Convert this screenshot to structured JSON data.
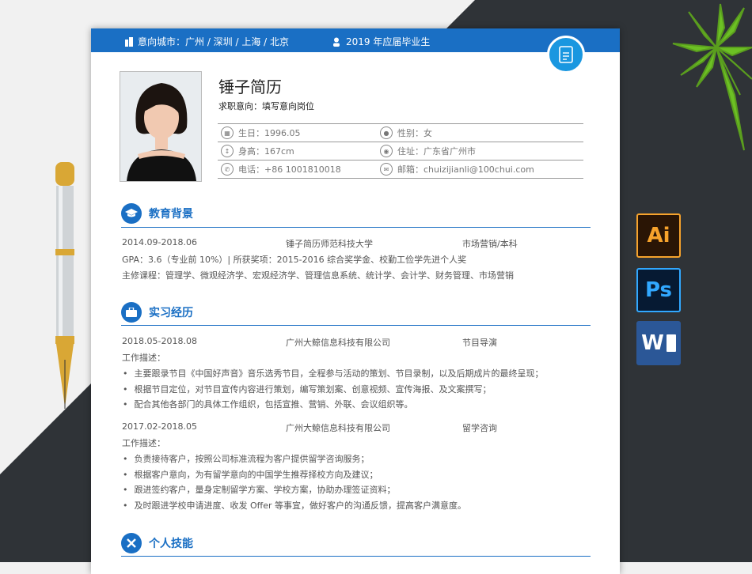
{
  "header": {
    "cities": "意向城市：广州 / 深圳 / 上海 / 北京",
    "grad": "2019 年应届毕业生"
  },
  "profile": {
    "name": "锤子简历",
    "intent": "求职意向：填写意向岗位",
    "birth": "生日：1996.05",
    "gender": "性别：女",
    "height": "身高：167cm",
    "address": "住址：广东省广州市",
    "phone": "电话：+86 1001810018",
    "email": "邮箱：chuizijianli@100chui.com"
  },
  "education": {
    "title": "教育背景",
    "period": "2014.09-2018.06",
    "school": "锤子简历师范科技大学",
    "major": "市场营销/本科",
    "gpa": "GPA：3.6（专业前 10%）| 所获奖项：2015-2016 综合奖学金、校勤工俭学先进个人奖",
    "courses": "主修课程：管理学、微观经济学、宏观经济学、管理信息系统、统计学、会计学、财务管理、市场营销"
  },
  "internship": {
    "title": "实习经历",
    "jobs": [
      {
        "period": "2018.05-2018.08",
        "company": "广州大鲸信息科技有限公司",
        "role": "节目导演",
        "desc_label": "工作描述：",
        "bullets": [
          "主要跟录节目《中国好声音》音乐选秀节目，全程参与活动的策划、节目录制，以及后期成片的最终呈现；",
          "根据节目定位，对节目宣传内容进行策划，编写策划案、创意视频、宣传海报、及文案撰写；",
          "配合其他各部门的具体工作组织，包括宣推、营销、外联、会议组织等。"
        ]
      },
      {
        "period": "2017.02-2018.05",
        "company": "广州大鲸信息科技有限公司",
        "role": "留学咨询",
        "desc_label": "工作描述：",
        "bullets": [
          "负责接待客户，按照公司标准流程为客户提供留学咨询服务；",
          "根据客户意向，为有留学意向的中国学生推荐择校方向及建议；",
          "跟进签约客户，量身定制留学方案、学校方案，协助办理签证资料；",
          "及时跟进学校申请进度、收发 Offer 等事宜，做好客户的沟通反馈，提高客户满意度。"
        ]
      }
    ]
  },
  "skills": {
    "title": "个人技能"
  },
  "apps": {
    "ai": "Ai",
    "ps": "Ps",
    "word": "W"
  },
  "colors": {
    "accent": "#1a6fc4",
    "badge": "#1a97e0",
    "dark_bg": "#2f3337"
  }
}
